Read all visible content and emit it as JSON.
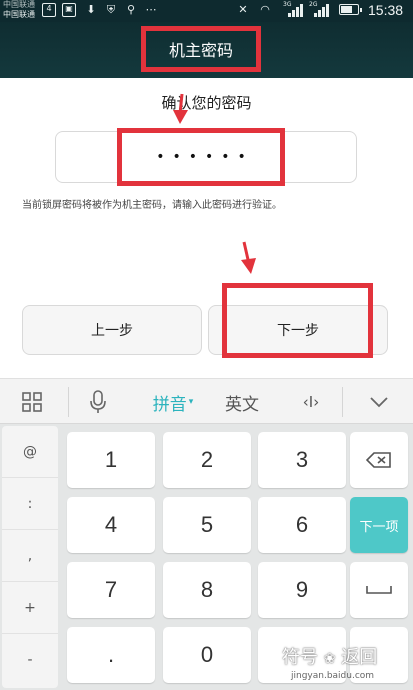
{
  "status_bar": {
    "carrier_line1": "中国联通",
    "carrier_line2": "中国联通",
    "net_tag_1": "3G",
    "net_tag_2": "2G",
    "time": "15:38",
    "battery_level": 0.7
  },
  "header": {
    "title": "机主密码"
  },
  "main": {
    "heading": "确认您的密码",
    "password_mask": "••••••",
    "hint": "当前锁屏密码将被作为机主密码，请输入此密码进行验证。",
    "prev_button": "上一步",
    "next_button": "下一步"
  },
  "keyboard": {
    "toolbar": {
      "grid_icon": "grid-icon",
      "mic_icon": "mic-icon",
      "pinyin": "拼音",
      "english": "英文",
      "cursor": "‹I›",
      "collapse_icon": "chevron-down-icon"
    },
    "side_keys": [
      "@",
      ":",
      ",",
      "+",
      "-"
    ],
    "digits": [
      "1",
      "2",
      "3",
      "4",
      "5",
      "6",
      "7",
      "8",
      "9",
      ".",
      "0"
    ],
    "next_item": "下一项",
    "accent_color": "#4ec8c8"
  },
  "watermark": {
    "text": "符号",
    "text_back": "返回",
    "sub": "jingyan.baidu.com"
  },
  "colors": {
    "highlight": "#e2333c",
    "titlebar": "#12363a"
  }
}
